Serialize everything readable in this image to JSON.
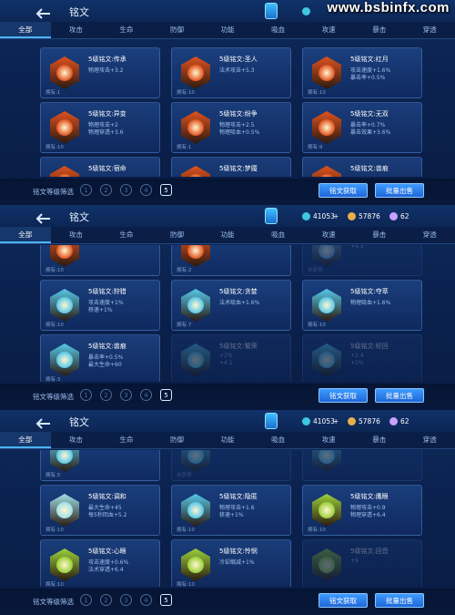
{
  "watermark": "www.bsbinfx.com",
  "colors": {
    "accent": "#3e9bff",
    "bg": "#0a1a3a"
  },
  "hud": {
    "coins": "41053",
    "gems": "57876",
    "crystals": "62"
  },
  "title": "铭文",
  "tabs": [
    "全部",
    "攻击",
    "生命",
    "防御",
    "功能",
    "吸血",
    "攻速",
    "暴击",
    "穿透"
  ],
  "filter_label": "铭文等级筛选",
  "levels": [
    "1",
    "2",
    "3",
    "4",
    "5"
  ],
  "buttons": {
    "get": "铭文获取",
    "sell": "批量出售"
  },
  "panels": [
    {
      "cards": [
        {
          "name": "5级铭文:传承",
          "s1": "物理攻击+3.2",
          "s2": "",
          "own": "拥有:1",
          "c": "#e0521e",
          "dim": false
        },
        {
          "name": "5级铭文:圣人",
          "s1": "法术攻击+5.3",
          "s2": "",
          "own": "拥有:10",
          "c": "#e0521e",
          "dim": false
        },
        {
          "name": "5级铭文:红月",
          "s1": "攻击速度+1.6%",
          "s2": "暴击率+0.5%",
          "own": "拥有:10",
          "c": "#e0521e",
          "dim": false
        },
        {
          "name": "5级铭文:异变",
          "s1": "物理攻击+2",
          "s2": "物理穿透+3.6",
          "own": "拥有:10",
          "c": "#e0521e",
          "dim": false
        },
        {
          "name": "5级铭文:纷争",
          "s1": "物理攻击+2.5",
          "s2": "物理吸血+0.5%",
          "own": "拥有:1",
          "c": "#e0521e",
          "dim": false
        },
        {
          "name": "5级铭文:无双",
          "s1": "暴击率+0.7%",
          "s2": "暴击效果+3.6%",
          "own": "拥有:9",
          "c": "#e0521e",
          "dim": false
        },
        {
          "name": "5级铭文:宿命",
          "s1": "",
          "s2": "",
          "own": "",
          "c": "#e0521e",
          "dim": false
        },
        {
          "name": "5级铭文:梦魇",
          "s1": "",
          "s2": "",
          "own": "",
          "c": "#e0521e",
          "dim": false
        },
        {
          "name": "5级铭文:兽痕",
          "s1": "",
          "s2": "",
          "own": "",
          "c": "#e0521e",
          "dim": false
        }
      ]
    },
    {
      "cards": [
        {
          "name": "",
          "s1": "",
          "s2": "",
          "own": "拥有:10",
          "c": "#e0521e",
          "dim": false
        },
        {
          "name": "",
          "s1": "",
          "s2": "",
          "own": "拥有:2",
          "c": "#e0521e",
          "dim": false
        },
        {
          "name": "",
          "s1": "+4.5",
          "s2": "",
          "own": "未获得",
          "c": "#6aa8d8",
          "dim": true
        },
        {
          "name": "5级铭文:狩猎",
          "s1": "攻击速度+1%",
          "s2": "移速+1%",
          "own": "拥有:10",
          "c": "#56c8e8",
          "dim": false
        },
        {
          "name": "5级铭文:贪婪",
          "s1": "法术吸血+1.6%",
          "s2": "",
          "own": "拥有:7",
          "c": "#56c8e8",
          "dim": false
        },
        {
          "name": "5级铭文:夺萃",
          "s1": "物理吸血+1.6%",
          "s2": "",
          "own": "拥有:10",
          "c": "#56c8e8",
          "dim": false
        },
        {
          "name": "5级铭文:兽痕",
          "s1": "暴击率+0.5%",
          "s2": "最大生命+60",
          "own": "拥有:3",
          "c": "#56c8e8",
          "dim": false
        },
        {
          "name": "5级铭文:繁荣",
          "s1": "+1%",
          "s2": "+4.1",
          "own": "",
          "c": "#56c8e8",
          "dim": true
        },
        {
          "name": "5级铭文:轮回",
          "s1": "+2.4",
          "s2": "+1%",
          "own": "",
          "c": "#56c8e8",
          "dim": true
        }
      ]
    },
    {
      "cards": [
        {
          "name": "",
          "s1": "",
          "s2": "",
          "own": "拥有:5",
          "c": "#56c8e8",
          "dim": false
        },
        {
          "name": "",
          "s1": "",
          "s2": "",
          "own": "未获得",
          "c": "#56c8e8",
          "dim": true
        },
        {
          "name": "",
          "s1": "",
          "s2": "",
          "own": "",
          "c": "#56c8e8",
          "dim": true
        },
        {
          "name": "5级铭文:调和",
          "s1": "最大生命+45",
          "s2": "每5秒回血+5.2",
          "own": "拥有:10",
          "c": "#9fe0e8",
          "dim": false
        },
        {
          "name": "5级铭文:隐匿",
          "s1": "物理攻击+1.6",
          "s2": "移速+1%",
          "own": "拥有:10",
          "c": "#56c8e8",
          "dim": false
        },
        {
          "name": "5级铭文:鹰眼",
          "s1": "物理攻击+0.9",
          "s2": "物理穿透+6.4",
          "own": "拥有:10",
          "c": "#9ad03a",
          "dim": false
        },
        {
          "name": "5级铭文:心眼",
          "s1": "攻击速度+0.6%",
          "s2": "法术穿透+6.4",
          "own": "拥有:10",
          "c": "#9ad03a",
          "dim": false
        },
        {
          "name": "5级铭文:怜悯",
          "s1": "冷却缩减+1%",
          "s2": "",
          "own": "拥有:10",
          "c": "#9ad03a",
          "dim": false
        },
        {
          "name": "5级铭文:回音",
          "s1": "+9",
          "s2": "",
          "own": "",
          "c": "#9ad03a",
          "dim": true
        }
      ]
    }
  ]
}
